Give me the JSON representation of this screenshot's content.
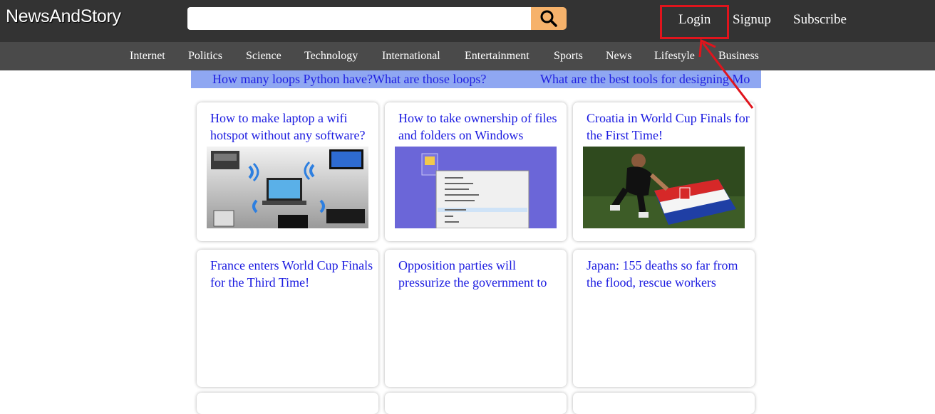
{
  "header": {
    "logo": "NewsAndStory",
    "search": {
      "placeholder": "",
      "value": ""
    },
    "links": {
      "login": "Login",
      "signup": "Signup",
      "subscribe": "Subscribe"
    }
  },
  "nav": [
    "Internet",
    "Politics",
    "Science",
    "Technology",
    "International",
    "Entertainment",
    "Sports",
    "News",
    "Lifestyle",
    "Business"
  ],
  "ticker": [
    "How many loops Python have?What are those loops?",
    "What are the best tools for designing Mo"
  ],
  "cards": [
    {
      "title": "How to make laptop a wifi hotspot without any software?",
      "image": "wifi-devices"
    },
    {
      "title": "How to take ownership of files and folders on Windows",
      "image": "windows-context-menu"
    },
    {
      "title": "Croatia in World Cup Finals for the First Time!",
      "image": "croatia-flag-player"
    },
    {
      "title": "France enters World Cup Finals for the Third Time!",
      "image": ""
    },
    {
      "title": "Opposition parties will pressurize the government to",
      "image": ""
    },
    {
      "title": "Japan: 155 deaths so far from the flood, rescue workers",
      "image": ""
    }
  ],
  "colors": {
    "accent": "#f6b26b",
    "highlight": "#e0141c",
    "link": "#1a1ae0",
    "ticker_bg": "#8fa7f2"
  }
}
